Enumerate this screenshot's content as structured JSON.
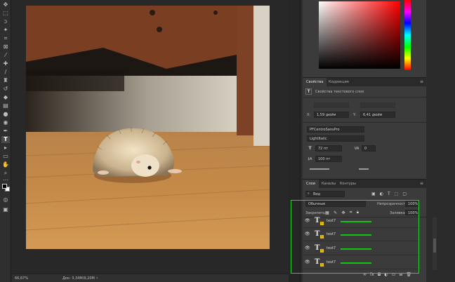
{
  "toolbar": {
    "tools": [
      "move",
      "marquee",
      "lasso",
      "magic-wand",
      "crop",
      "frame",
      "eyedropper",
      "healing",
      "brush",
      "clone-stamp",
      "history-brush",
      "eraser",
      "gradient",
      "blur",
      "dodge",
      "pen",
      "type",
      "path-selection",
      "rectangle",
      "hand",
      "zoom",
      "more"
    ]
  },
  "statusbar": {
    "zoom": "66,67%",
    "doc": "Док: 3,34M/9,20M",
    "arrow": "›"
  },
  "properties": {
    "tabs": [
      "Свойства",
      "Коррекция"
    ],
    "header": "Свойства текстового слоя",
    "x_label": "X:",
    "x_value": "1,59 дюйм",
    "y_label": "Y:",
    "y_value": "6,41 дюйм",
    "font_family": "PFCentroSansPro",
    "font_style": "LightItalic",
    "font_size": "72 пт",
    "tracking": "0",
    "leading": "100 пт"
  },
  "layers": {
    "tabs": [
      "Слои",
      "Каналы",
      "Контуры"
    ],
    "filter": "Вид",
    "blend_mode": "Обычные",
    "opacity_label": "Непрозрачность:",
    "opacity_value": "100%",
    "lock_label": "Закрепить:",
    "fill_label": "Заливка:",
    "fill_value": "100%",
    "items": [
      {
        "name": "text7"
      },
      {
        "name": "text7"
      },
      {
        "name": "text7"
      },
      {
        "name": "text7"
      }
    ]
  },
  "colors": {
    "highlight": "#2bd12b",
    "layer_marker": "#11c511"
  }
}
